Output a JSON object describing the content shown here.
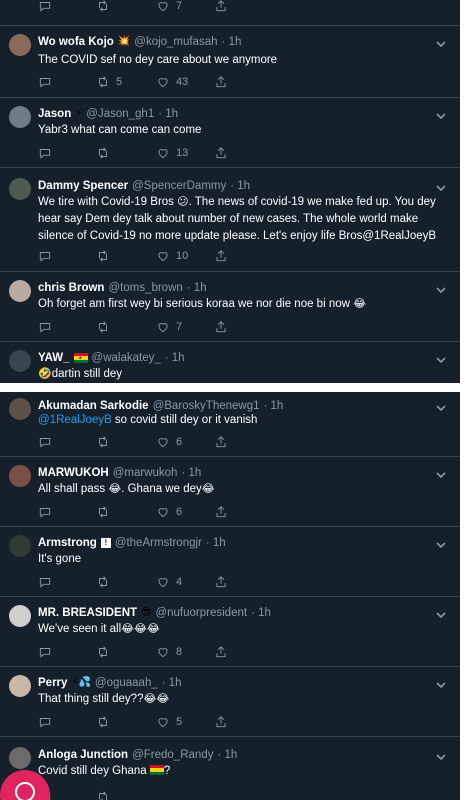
{
  "colors": {
    "background": "#15202b",
    "separator": "#38444d",
    "text": "#ffffff",
    "muted": "#8899a6",
    "link": "#1da1f2"
  },
  "top_actions": {
    "like_count": "7"
  },
  "tweets_top": [
    {
      "name": "Wo wofa Kojo",
      "handle": "@kojo_mufasah",
      "time": "· 1h",
      "text": "The COVID sef no dey care about we anymore",
      "retweets": "5",
      "likes": "43",
      "avatar_color": "#8a6b5a"
    },
    {
      "name": "Jason",
      "handle": "@Jason_gh1",
      "time": "· 1h",
      "text": "Yabr3 what can come can come",
      "retweets": "",
      "likes": "13",
      "avatar_color": "#6f7d86"
    },
    {
      "name": "Dammy Spencer",
      "handle": "@SpencerDammy",
      "time": "· 1h",
      "text_a": "We tire with Covid-19 Bros",
      "text_b": ". The news of covid-19 we make fed up. You dey hear say Dem dey talk about number of new cases. The whole world make silence of Covid-19 no more update please. Let's enjoy life Bros@1RealJoeyB",
      "retweets": "",
      "likes": "10",
      "avatar_color": "#4f5a52"
    },
    {
      "name": "chris Brown",
      "handle": "@toms_brown",
      "time": "· 1h",
      "text": "Oh forget am first wey bi serious koraa we nor die noe bi now",
      "retweets": "",
      "likes": "7",
      "avatar_color": "#b9a9a0"
    },
    {
      "name": "YAW_",
      "handle": "@walakatey_",
      "time": "· 1h",
      "text": "dartin still dey",
      "avatar_color": "#3a4550"
    }
  ],
  "tweets_bottom": [
    {
      "name": "Akumadan Sarkodie",
      "handle": "@BaroskyThenewg1",
      "time": "· 1h",
      "mention": "@1RealJoeyB",
      "text": " so covid still dey or it vanish",
      "retweets": "",
      "likes": "6",
      "avatar_color": "#5d5046"
    },
    {
      "name": "MARWUKOH",
      "handle": "@marwukoh",
      "time": "· 1h",
      "text_a": "All shall pass",
      "text_b": ". Ghana we dey",
      "retweets": "",
      "likes": "6",
      "avatar_color": "#7a4f4a"
    },
    {
      "name": "Armstrong",
      "handle": "@theArmstrongjr",
      "time": "· 1h",
      "text": "It's gone",
      "retweets": "",
      "likes": "4",
      "avatar_color": "#2f3a33"
    },
    {
      "name": "MR. BREASIDENT",
      "handle": "@nufuorpresident",
      "time": "· 1h",
      "text": "We've seen it all",
      "retweets": "",
      "likes": "8",
      "avatar_color": "#cfcfcf"
    },
    {
      "name": "Perry",
      "handle": "@oguaaah_",
      "time": "· 1h",
      "text": "That thing still dey??",
      "retweets": "",
      "likes": "5",
      "avatar_color": "#c9b8a6"
    },
    {
      "name": "Anloga Junction",
      "handle": "@Fredo_Randy",
      "time": "· 1h",
      "text": "Covid still dey Ghana ",
      "text_end": "?",
      "avatar_color": "#6b6b6b"
    }
  ],
  "icons": {
    "reply": "reply-icon",
    "retweet": "retweet-icon",
    "like": "heart-icon",
    "share": "share-icon",
    "more": "chevron-down-icon",
    "fab": "compose-icon"
  }
}
